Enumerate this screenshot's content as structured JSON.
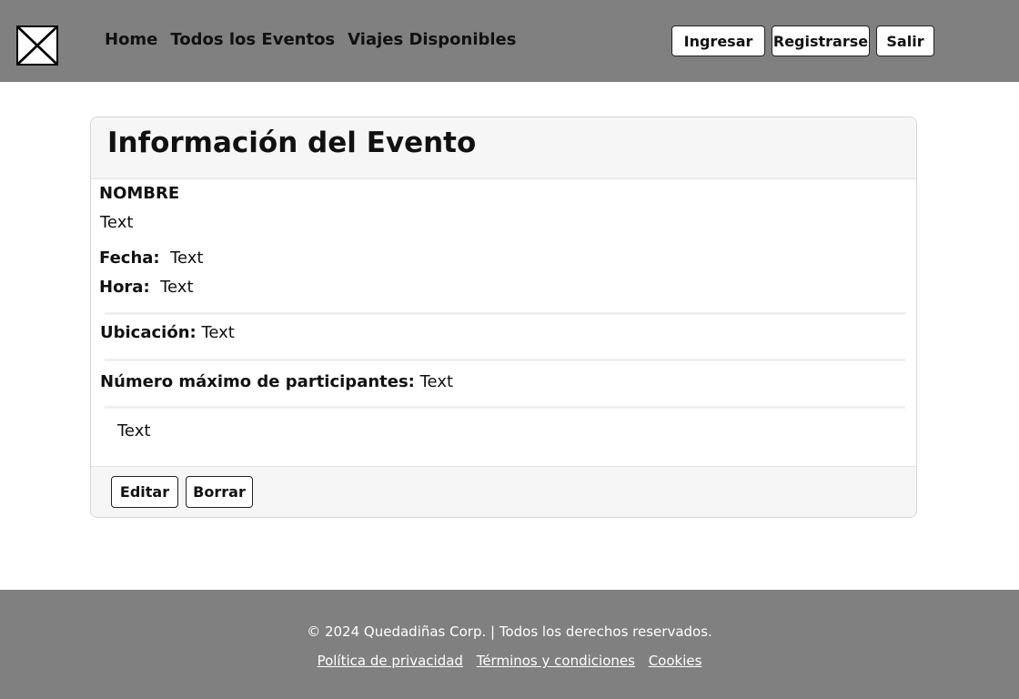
{
  "header": {
    "logo_icon": "placeholder-image-icon",
    "nav": {
      "home": "Home",
      "all_events": "Todos los Eventos",
      "trips": "Viajes Disponibles"
    },
    "auth": {
      "login": "Ingresar",
      "register": "Registrarse",
      "logout": "Salir"
    }
  },
  "card": {
    "title": "Información del Evento",
    "name_label": "NOMBRE",
    "name_value": "Text",
    "date_label": "Fecha:",
    "date_value": "Text",
    "time_label": "Hora:",
    "time_value": "Text",
    "location_label": "Ubicación:",
    "location_value": "Text",
    "max_label": "Número máximo de participantes:",
    "max_value": "Text",
    "description": "Text",
    "edit_label": "Editar",
    "delete_label": "Borrar"
  },
  "footer": {
    "copyright": "© 2024 Quedadiñas Corp. | Todos los derechos reservados.",
    "privacy": "Política de privacidad",
    "terms": "Términos y condiciones",
    "cookies": "Cookies"
  },
  "colors": {
    "header_bg": "#808080",
    "footer_bg": "#808080",
    "card_header_bg": "#f6f6f6"
  }
}
